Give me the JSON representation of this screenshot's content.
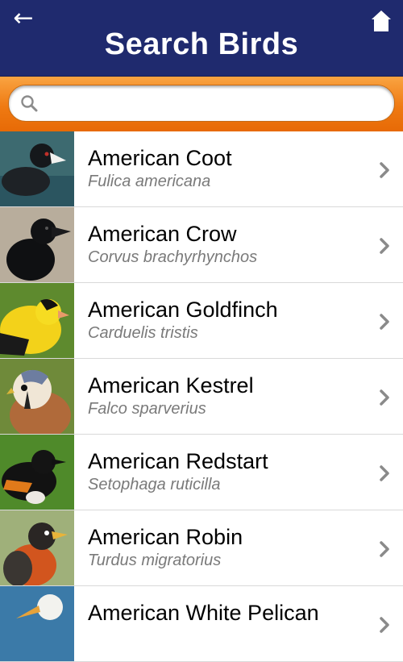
{
  "header": {
    "title": "Search Birds",
    "back_icon": "arrow-left-icon",
    "home_icon": "home-icon",
    "background": "#1f2a6e"
  },
  "search": {
    "placeholder": "",
    "value": "",
    "icon": "search-icon",
    "bar_color": "#ef7a12"
  },
  "birds": [
    {
      "name": "American Coot",
      "scientific": "Fulica americana"
    },
    {
      "name": "American Crow",
      "scientific": "Corvus brachyrhynchos"
    },
    {
      "name": "American Goldfinch",
      "scientific": "Carduelis tristis"
    },
    {
      "name": "American Kestrel",
      "scientific": "Falco sparverius"
    },
    {
      "name": "American Redstart",
      "scientific": "Setophaga ruticilla"
    },
    {
      "name": "American Robin",
      "scientific": "Turdus migratorius"
    },
    {
      "name": "American White Pelican",
      "scientific": ""
    }
  ]
}
